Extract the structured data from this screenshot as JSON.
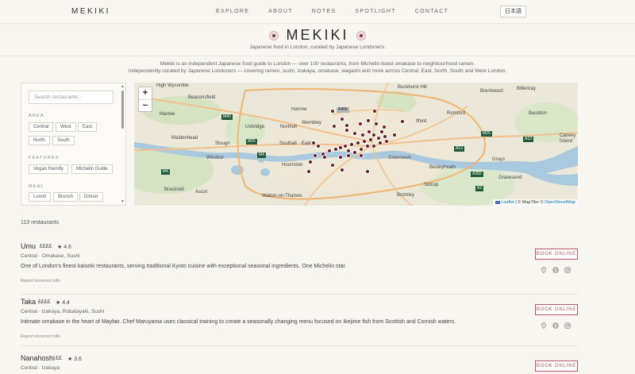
{
  "nav": {
    "brand": "MEKIKI",
    "links": [
      "EXPLORE",
      "ABOUT",
      "NOTES",
      "SPOTLIGHT",
      "CONTACT"
    ],
    "language_button": "日本語"
  },
  "hero": {
    "title": "MEKIKI",
    "subtitle": "Japanese food in London, curated by Japanese Londoners."
  },
  "intro": {
    "line1": "Mekiki is an independent Japanese food guide to London — over 100 restaurants, from Michelin-listed omakase to neighbourhood ramen.",
    "line2": "Independently curated by Japanese Londoners — covering ramen, sushi, izakaya, omakase, wagashi and more across Central, East, North, South and West London."
  },
  "filters": {
    "search_placeholder": "Search restaurants...",
    "area_label": "AREA",
    "area_chips": [
      "Central",
      "West",
      "East",
      "North",
      "South"
    ],
    "features_label": "FEATURES",
    "feature_chips": [
      "Vegan friendly",
      "Michelin Guide"
    ],
    "meal_label": "MEAL",
    "meal_chips": [
      "Lunch",
      "Brunch",
      "Dinner"
    ]
  },
  "map": {
    "zoom_in": "+",
    "zoom_out": "−",
    "attribution_leaflet": "Leaflet",
    "attribution_rest": " | © MapTiler © ",
    "attribution_osm": "OpenStreetMap",
    "places": [
      "High Wycombe",
      "Beaconsfield",
      "Marlow",
      "Maidenhead",
      "Bracknell",
      "Ascot",
      "Windsor",
      "Slough",
      "Uxbridge",
      "Harrow",
      "Wembley",
      "Northolt",
      "Ealing",
      "Southall",
      "Hounslow",
      "Walton-on-Thames",
      "Ilford",
      "Romford",
      "Basildon",
      "Brentwood",
      "Billericay",
      "Grays",
      "Gravesend",
      "Greenwich",
      "Bexleyheath",
      "Sidcup",
      "Bromley",
      "Buckhurst Hill",
      "Canvey Island"
    ],
    "roads": [
      "M40",
      "M25",
      "M4",
      "A406",
      "A13",
      "A282",
      "A2",
      "M25",
      "A13",
      "M4"
    ],
    "marker_color": "#6b1f2e"
  },
  "results": {
    "count_label": "113 restaurants",
    "restaurants": [
      {
        "name": "Umu",
        "price": "££££",
        "rating": "★ 4.6",
        "tags": "Central · Omakase, Sushi",
        "description": "One of London's finest kaiseki restaurants, serving traditional Kyoto cuisine with exceptional seasonal ingredients. One Michelin star.",
        "report": "Report incorrect info",
        "book": "BOOK ONLINE"
      },
      {
        "name": "Taka",
        "price": "££££",
        "rating": "★ 4.4",
        "tags": "Central · Izakaya, Robatayaki, Sushi",
        "description": "Intimate omakase in the heart of Mayfair. Chef Maruyama uses classical training to create a seasonally changing menu focused on Ikejime fish from Scottish and Cornish waters.",
        "report": "Report incorrect info",
        "book": "BOOK ONLINE"
      },
      {
        "name": "Nanahoshi",
        "price": "££",
        "rating": "★ 3.6",
        "tags": "Central · Izakaya",
        "description": "",
        "report": "",
        "book": "BOOK ONLINE"
      }
    ]
  },
  "colors": {
    "accent": "#b25665",
    "background": "#f8f6f1",
    "water": "#a9c9de",
    "green": "#c9dfb7"
  }
}
